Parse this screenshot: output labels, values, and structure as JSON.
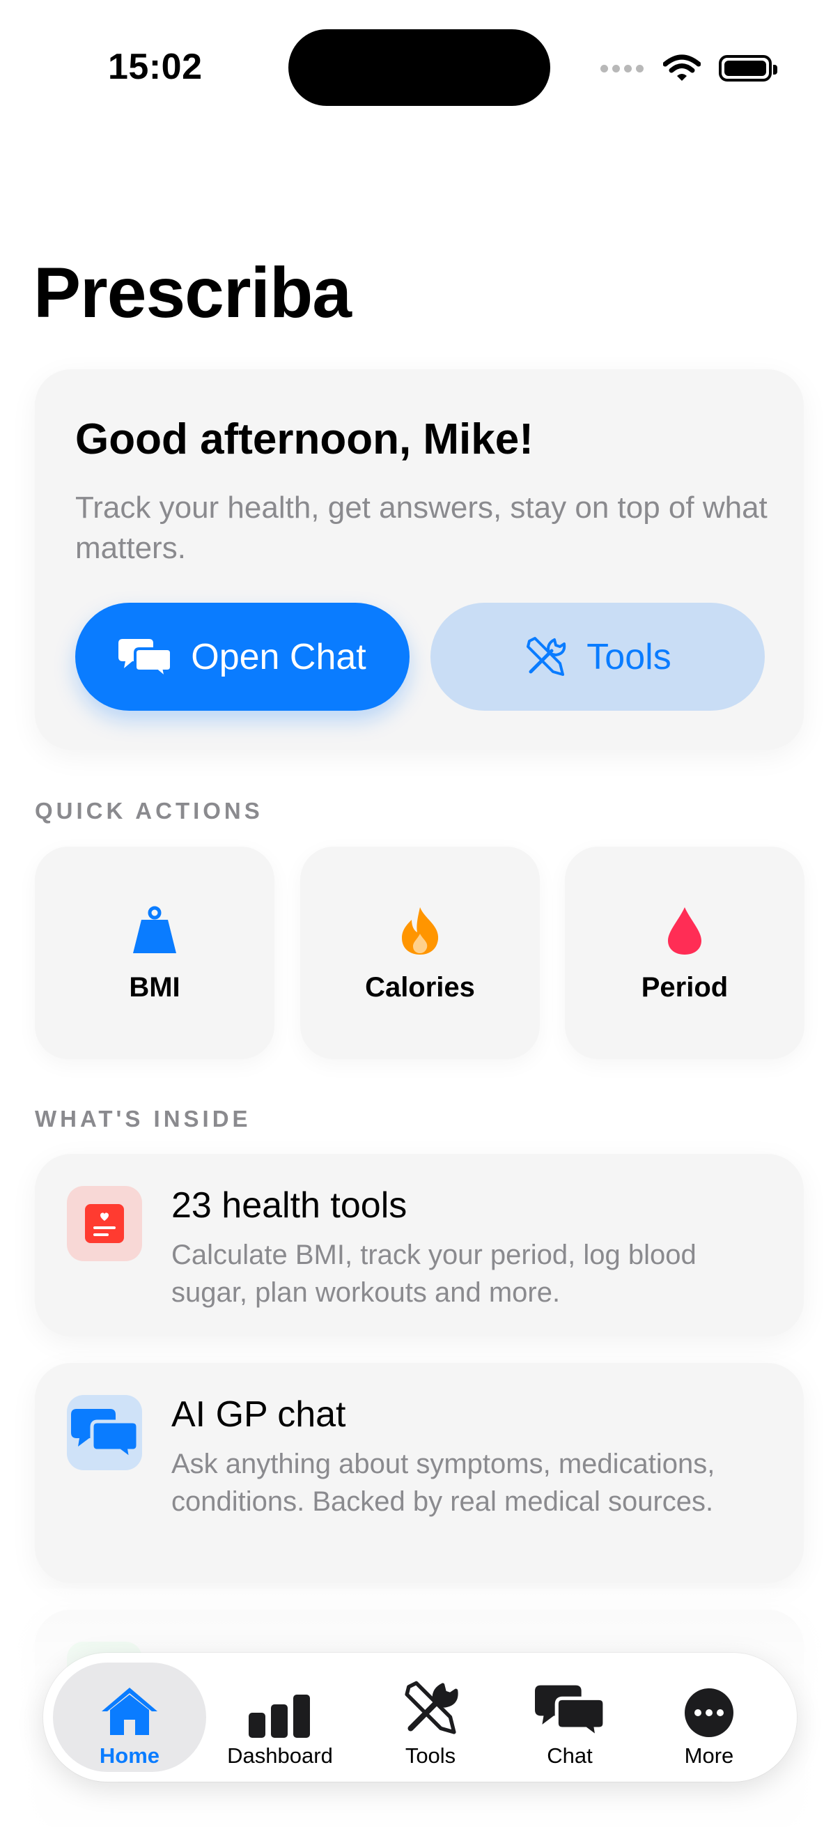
{
  "status_bar": {
    "time": "15:02"
  },
  "app": {
    "title": "Prescriba"
  },
  "hero": {
    "greeting": "Good afternoon, Mike!",
    "subtitle": "Track your health, get answers, stay on top of what matters.",
    "open_chat_label": "Open Chat",
    "tools_label": "Tools"
  },
  "quick_actions": {
    "heading": "QUICK ACTIONS",
    "items": [
      {
        "label": "BMI",
        "icon": "weight-icon",
        "color": "#0a7cff"
      },
      {
        "label": "Calories",
        "icon": "flame-icon",
        "color": "#ff9500"
      },
      {
        "label": "Period",
        "icon": "drop-icon",
        "color": "#ff2d55"
      }
    ]
  },
  "whats_inside": {
    "heading": "WHAT'S INSIDE",
    "items": [
      {
        "title": "23 health tools",
        "description": "Calculate BMI, track your period, log blood sugar, plan workouts and more.",
        "icon": "health-card-icon",
        "color": "#ff3b30"
      },
      {
        "title": "AI GP chat",
        "description": "Ask anything about symptoms, medications, conditions. Backed by real medical sources.",
        "icon": "chat-bubbles-icon",
        "color": "#0a7cff"
      }
    ]
  },
  "tab_bar": {
    "active": "Home",
    "items": [
      {
        "label": "Home",
        "icon": "house-icon"
      },
      {
        "label": "Dashboard",
        "icon": "bar-chart-icon"
      },
      {
        "label": "Tools",
        "icon": "tools-icon"
      },
      {
        "label": "Chat",
        "icon": "chat-bubbles-icon"
      },
      {
        "label": "More",
        "icon": "ellipsis-icon"
      }
    ]
  },
  "colors": {
    "accent": "#0a7cff",
    "card": "#f5f5f5",
    "secondary_text": "#8a8a8e"
  }
}
